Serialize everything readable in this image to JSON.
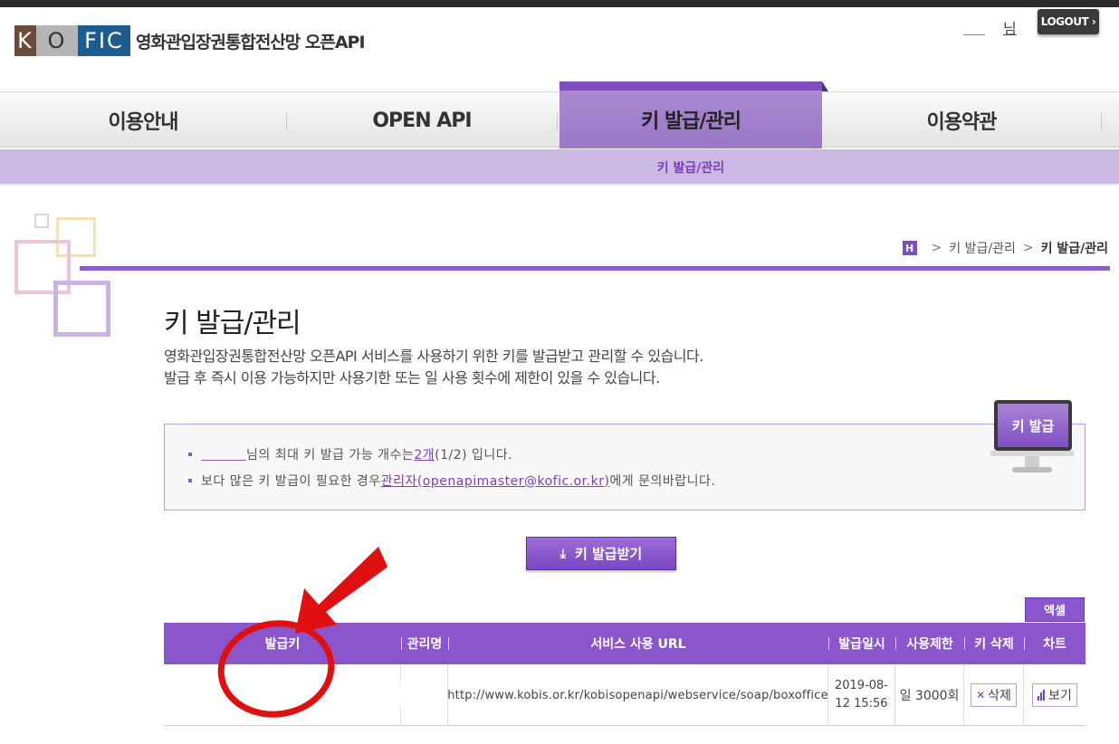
{
  "brand": {
    "logo_k": "K",
    "logo_o": "O",
    "logo_fic": "FIC",
    "site_name": "영화관입장권통합전산망 오픈API"
  },
  "user": {
    "suffix": "님",
    "logout_label": "LOGOUT ›"
  },
  "nav": {
    "items": [
      "이용안내",
      "OPEN API",
      "키 발급/관리",
      "이용약관"
    ],
    "active_index": 2,
    "sub_item": "키 발급/관리"
  },
  "breadcrumb": {
    "home": "H",
    "items": [
      "키 발급/관리",
      "키 발급/관리"
    ],
    "sep": ">"
  },
  "page": {
    "title": "키 발급/관리",
    "desc_line1": "영화관입장권통합전산망 오픈API 서비스를 사용하기 위한 키를 발급받고 관리할 수 있습니다.",
    "desc_line2": "발급 후 즉시 이용 가능하지만 사용기한 또는 일 사용 횟수에 제한이 있을 수 있습니다."
  },
  "info": {
    "line1_mid": "님의 최대 키 발급 가능 개수는 ",
    "line1_count": "2개",
    "line1_end": "(1/2) 입니다.",
    "line2_start": "보다 많은 키 발급이 필요한 경우 ",
    "line2_link": "관리자(openapimaster@kofic.or.kr)",
    "line2_end": "에게 문의바랍니다."
  },
  "monitor_label": "키 발급",
  "issue_button": "키 발급받기",
  "excel_button": "엑셀",
  "table": {
    "headers": [
      "발급키",
      "관리명",
      "서비스 사용 URL",
      "발급일시",
      "사용제한",
      "키 삭제",
      "차트"
    ],
    "rows": [
      {
        "key": "",
        "name": "",
        "url": "http://www.kobis.or.kr/kobisopenapi/webservice/soap/boxoffice",
        "issued": "2019-08-12 15:56",
        "limit": "일 3000회",
        "delete_label": "삭제",
        "chart_label": "보기"
      }
    ]
  },
  "colors": {
    "accent": "#8b55cc",
    "annotation": "#e01010"
  }
}
